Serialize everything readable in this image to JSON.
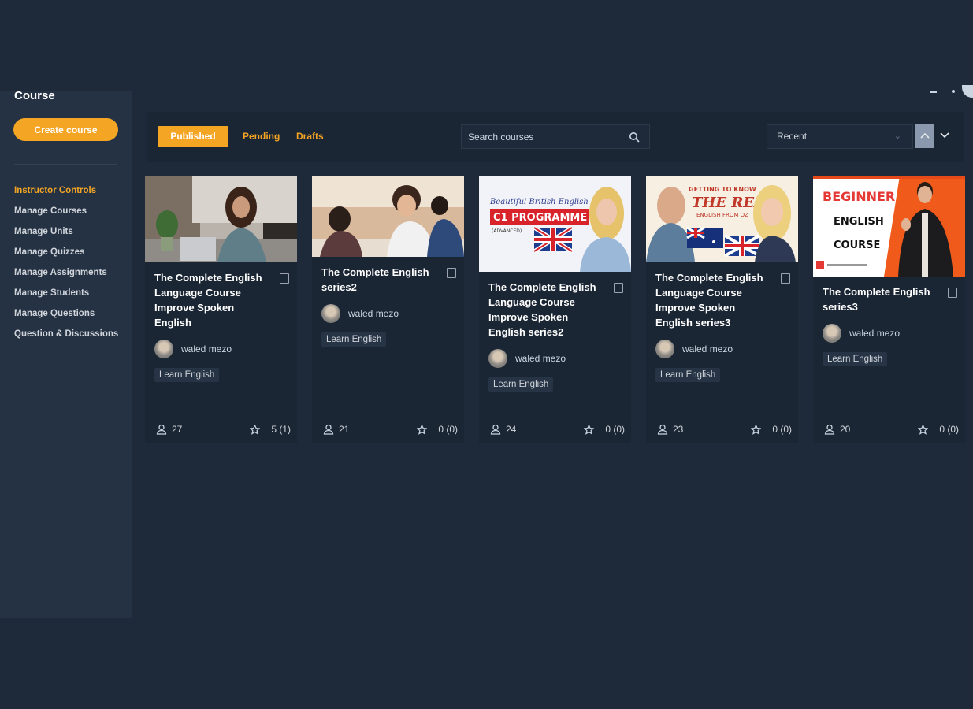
{
  "sidebar": {
    "title": "Course",
    "create_label": "Create course",
    "menu": [
      {
        "label": "Instructor Controls",
        "heading": true
      },
      {
        "label": "Manage Courses"
      },
      {
        "label": "Manage Units"
      },
      {
        "label": "Manage Quizzes"
      },
      {
        "label": "Manage Assignments"
      },
      {
        "label": "Manage Students"
      },
      {
        "label": "Manage Questions"
      },
      {
        "label": "Question & Discussions"
      }
    ]
  },
  "toolbar": {
    "tabs": {
      "published": "Published",
      "pending": "Pending",
      "drafts": "Drafts"
    },
    "search_placeholder": "Search courses",
    "sort_label": "Recent"
  },
  "colors": {
    "accent": "#f5a524",
    "background": "#1e2a3a",
    "card": "#1b2634",
    "sidebar": "#243243"
  },
  "courses": [
    {
      "title": "The Complete English Language Course Improve Spoken English",
      "author": "waled mezo",
      "tag": "Learn English",
      "students": "27",
      "rating": "5 (1)",
      "thumb_icon": "woman-laptop-photo"
    },
    {
      "title": "The Complete English series2",
      "author": "waled mezo",
      "tag": "Learn English",
      "students": "21",
      "rating": "0 (0)",
      "thumb_icon": "classroom-photo"
    },
    {
      "title": "The Complete English Language Course Improve Spoken English series2",
      "author": "waled mezo",
      "tag": "Learn English",
      "students": "24",
      "rating": "0 (0)",
      "thumb_icon": "british-english-thumbnail",
      "thumb_text": {
        "line1": "Beautiful British English",
        "line2": "C1 PROGRAMME",
        "line3": "(ADVANCED)"
      }
    },
    {
      "title": "The Complete English Language Course Improve Spoken English series3",
      "author": "waled mezo",
      "tag": "Learn English",
      "students": "23",
      "rating": "0 (0)",
      "thumb_icon": "australian-english-thumbnail",
      "thumb_text": {
        "line1": "GETTING TO KNOW",
        "line2": "THE REAL",
        "line3": "ENGLISH FROM OZ"
      }
    },
    {
      "title": "The Complete English series3",
      "author": "waled mezo",
      "tag": "Learn English",
      "students": "20",
      "rating": "0 (0)",
      "thumb_icon": "beginner-english-thumbnail",
      "thumb_text": {
        "line1": "BEGINNER",
        "line2": "ENGLISH",
        "line3": "COURSE"
      }
    }
  ]
}
